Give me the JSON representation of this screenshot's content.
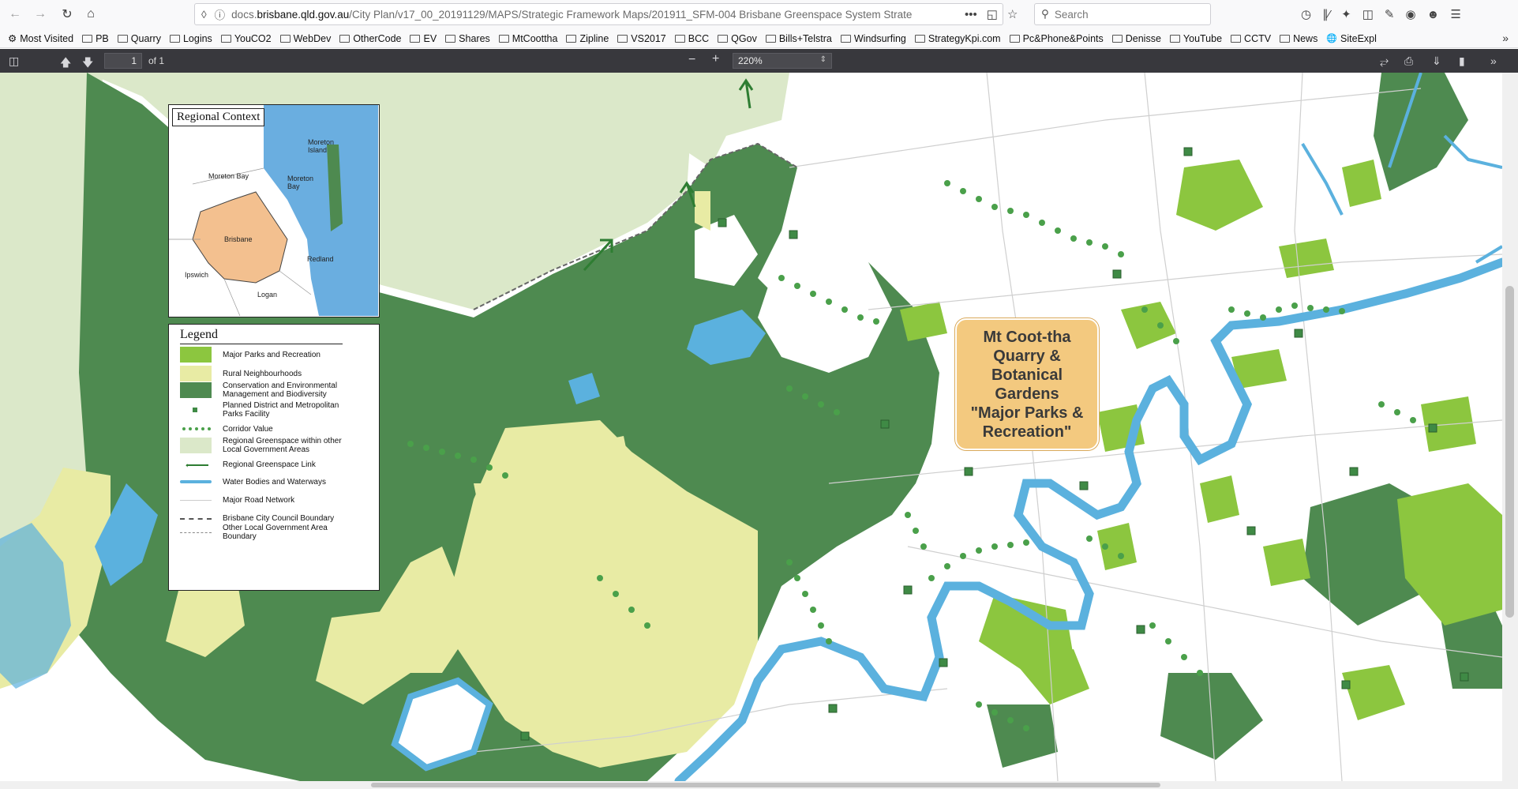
{
  "browser": {
    "url_prefix": "docs.",
    "url_host": "brisbane.qld.gov.au",
    "url_path": "/City Plan/v17_00_20191129/MAPS/Strategic Framework Maps/201911_SFM-004 Brisbane Greenspace System Strate",
    "search_placeholder": "Search",
    "more_icon": "•••"
  },
  "bookmarks": [
    {
      "label": "Most Visited",
      "icon": "gear-icon"
    },
    {
      "label": "PB"
    },
    {
      "label": "Quarry"
    },
    {
      "label": "Logins"
    },
    {
      "label": "YouCO2"
    },
    {
      "label": "WebDev"
    },
    {
      "label": "OtherCode"
    },
    {
      "label": "EV"
    },
    {
      "label": "Shares"
    },
    {
      "label": "MtCoottha"
    },
    {
      "label": "Zipline"
    },
    {
      "label": "VS2017"
    },
    {
      "label": "BCC"
    },
    {
      "label": "QGov"
    },
    {
      "label": "Bills+Telstra"
    },
    {
      "label": "Windsurfing"
    },
    {
      "label": "StrategyKpi.com"
    },
    {
      "label": "Pc&Phone&Points"
    },
    {
      "label": "Denisse"
    },
    {
      "label": "YouTube"
    },
    {
      "label": "CCTV"
    },
    {
      "label": "News"
    },
    {
      "label": "SiteExpl",
      "icon": "globe-icon"
    }
  ],
  "pdf": {
    "page_value": "1",
    "page_of": "of 1",
    "zoom": "220%"
  },
  "map": {
    "context": {
      "title": "Regional Context",
      "labels": {
        "moreton_island": "Moreton Island",
        "moreton_bay_region": "Moreton Bay",
        "moreton_bay_water": "Moreton Bay",
        "brisbane": "Brisbane",
        "redland": "Redland",
        "ipswich": "Ipswich",
        "logan": "Logan"
      }
    },
    "legend": {
      "title": "Legend",
      "items": [
        {
          "label": "Major Parks and Recreation",
          "color": "#8cc63f"
        },
        {
          "label": "Rural Neighbourhoods",
          "color": "#e8eba4"
        },
        {
          "label": "Conservation and Environmental Management and Biodiversity",
          "color": "#4e8a50"
        },
        {
          "label": "Planned District and Metropolitan Parks Facility",
          "color": "#3f8a45"
        },
        {
          "label": "Corridor Value",
          "color": "#4aa04a"
        },
        {
          "label": "Regional Greenspace within other Local Government Areas",
          "color": "#dbe8c9"
        },
        {
          "label": "Regional Greenspace Link",
          "color": "#2e7d32"
        },
        {
          "label": "Water Bodies and Waterways",
          "color": "#5bb1de"
        },
        {
          "label": "Major Road Network",
          "color": "#cccccc"
        },
        {
          "label": "Brisbane City Council Boundary",
          "color": "#555555"
        },
        {
          "label": "Other Local Government Area Boundary",
          "color": "#555555"
        }
      ]
    },
    "callout": {
      "lines": [
        "Mt Coot-tha",
        "Quarry &",
        "Botanical",
        "Gardens",
        "\"Major Parks &",
        "Recreation\""
      ]
    }
  }
}
